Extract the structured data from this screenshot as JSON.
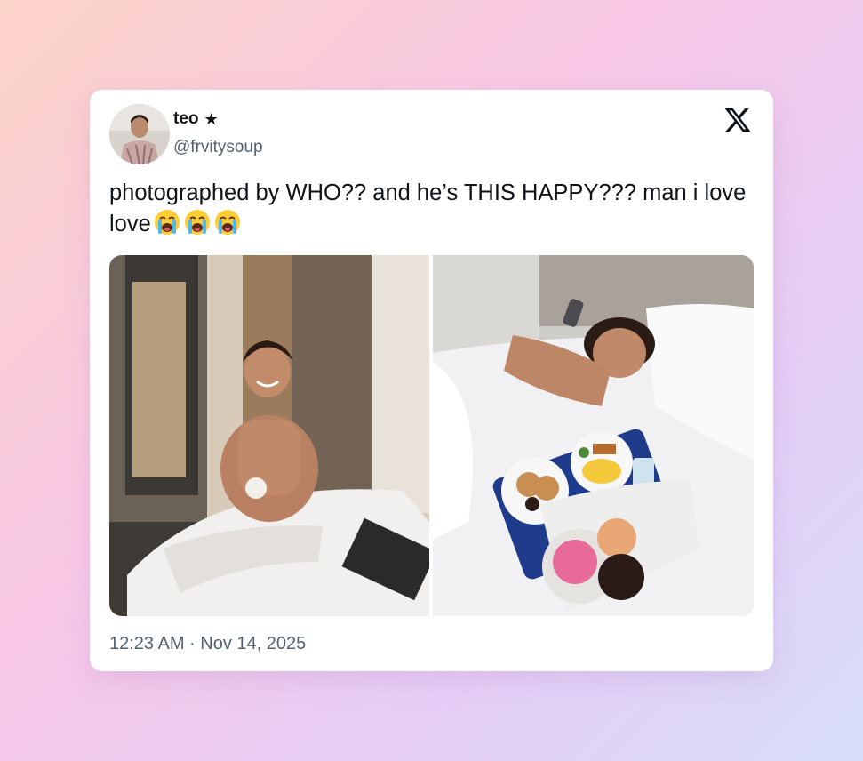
{
  "tweet": {
    "author": {
      "display_name": "teo",
      "badge": "★",
      "handle": "@frvitysoup"
    },
    "text": "photographed by WHO?? and he’s THIS HAPPY??? man i love love",
    "emoji": [
      "loudly-crying-face",
      "loudly-crying-face",
      "loudly-crying-face"
    ],
    "media": [
      {
        "name": "photo-hotel-room-smiling"
      },
      {
        "name": "photo-breakfast-in-bed"
      }
    ],
    "timestamp": "12:23 AM · Nov 14, 2025"
  },
  "icons": {
    "platform_logo": "x-logo-icon",
    "verified": "star-icon"
  },
  "colors": {
    "text": "#0f1419",
    "secondary": "#536471",
    "card": "#ffffff"
  }
}
